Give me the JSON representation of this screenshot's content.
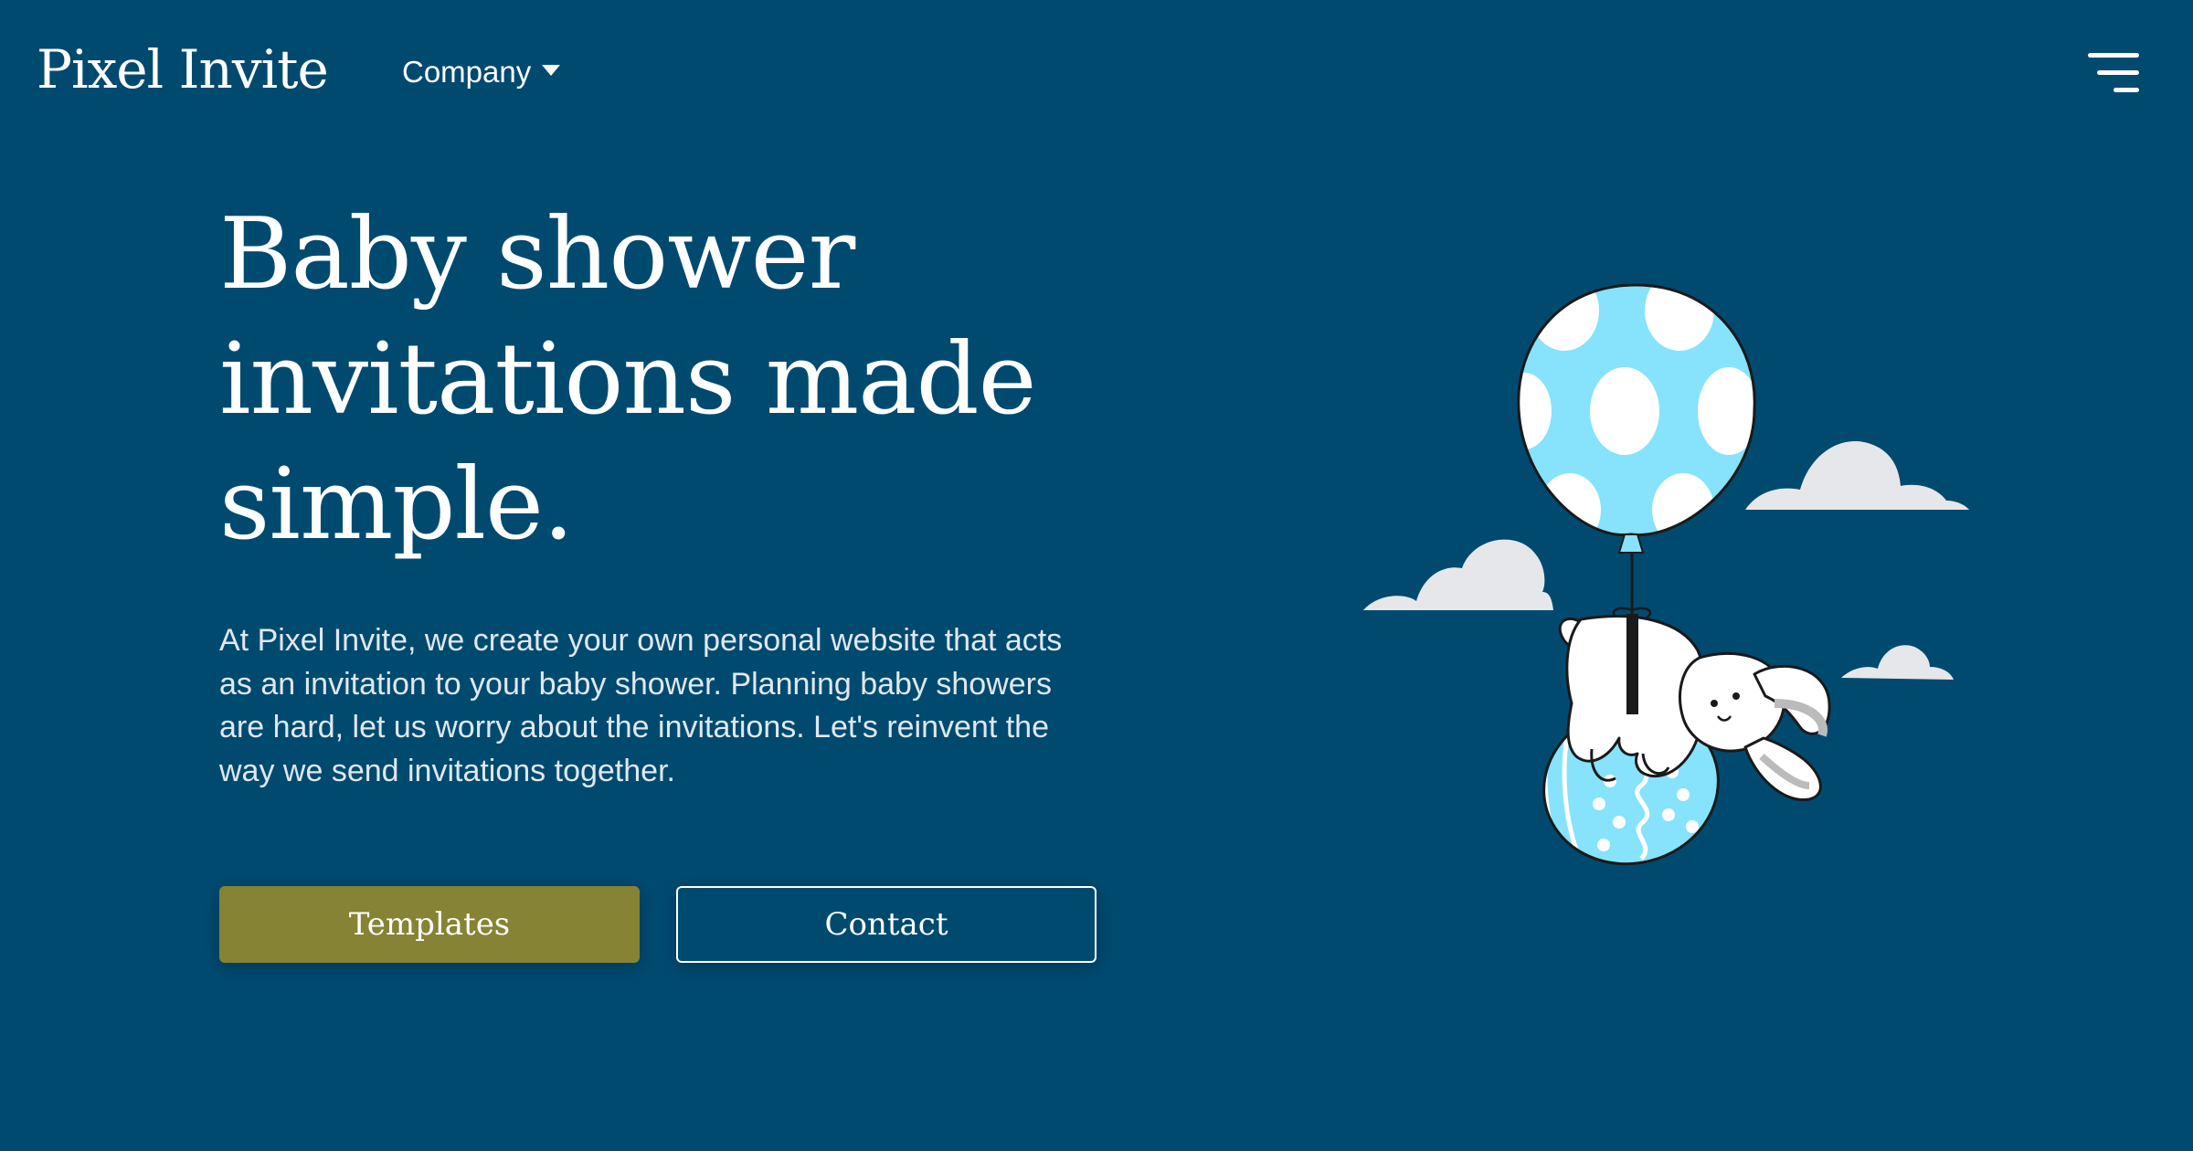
{
  "header": {
    "brand": "Pixel Invite",
    "nav": {
      "company_label": "Company"
    }
  },
  "hero": {
    "title": "Baby shower invitations made simple.",
    "description": "At Pixel Invite, we create your own personal website that acts as an invitation to your baby shower. Planning baby showers are hard, let us worry about the invitations. Let's reinvent the way we send invitations together.",
    "buttons": {
      "templates_label": "Templates",
      "contact_label": "Contact"
    }
  },
  "colors": {
    "background": "#004a70",
    "primary_button": "#868334",
    "balloon_blue": "#86e3fb",
    "text": "#ffffff"
  },
  "icons": {
    "menu": "hamburger-menu-icon",
    "company_caret": "caret-down-icon"
  }
}
